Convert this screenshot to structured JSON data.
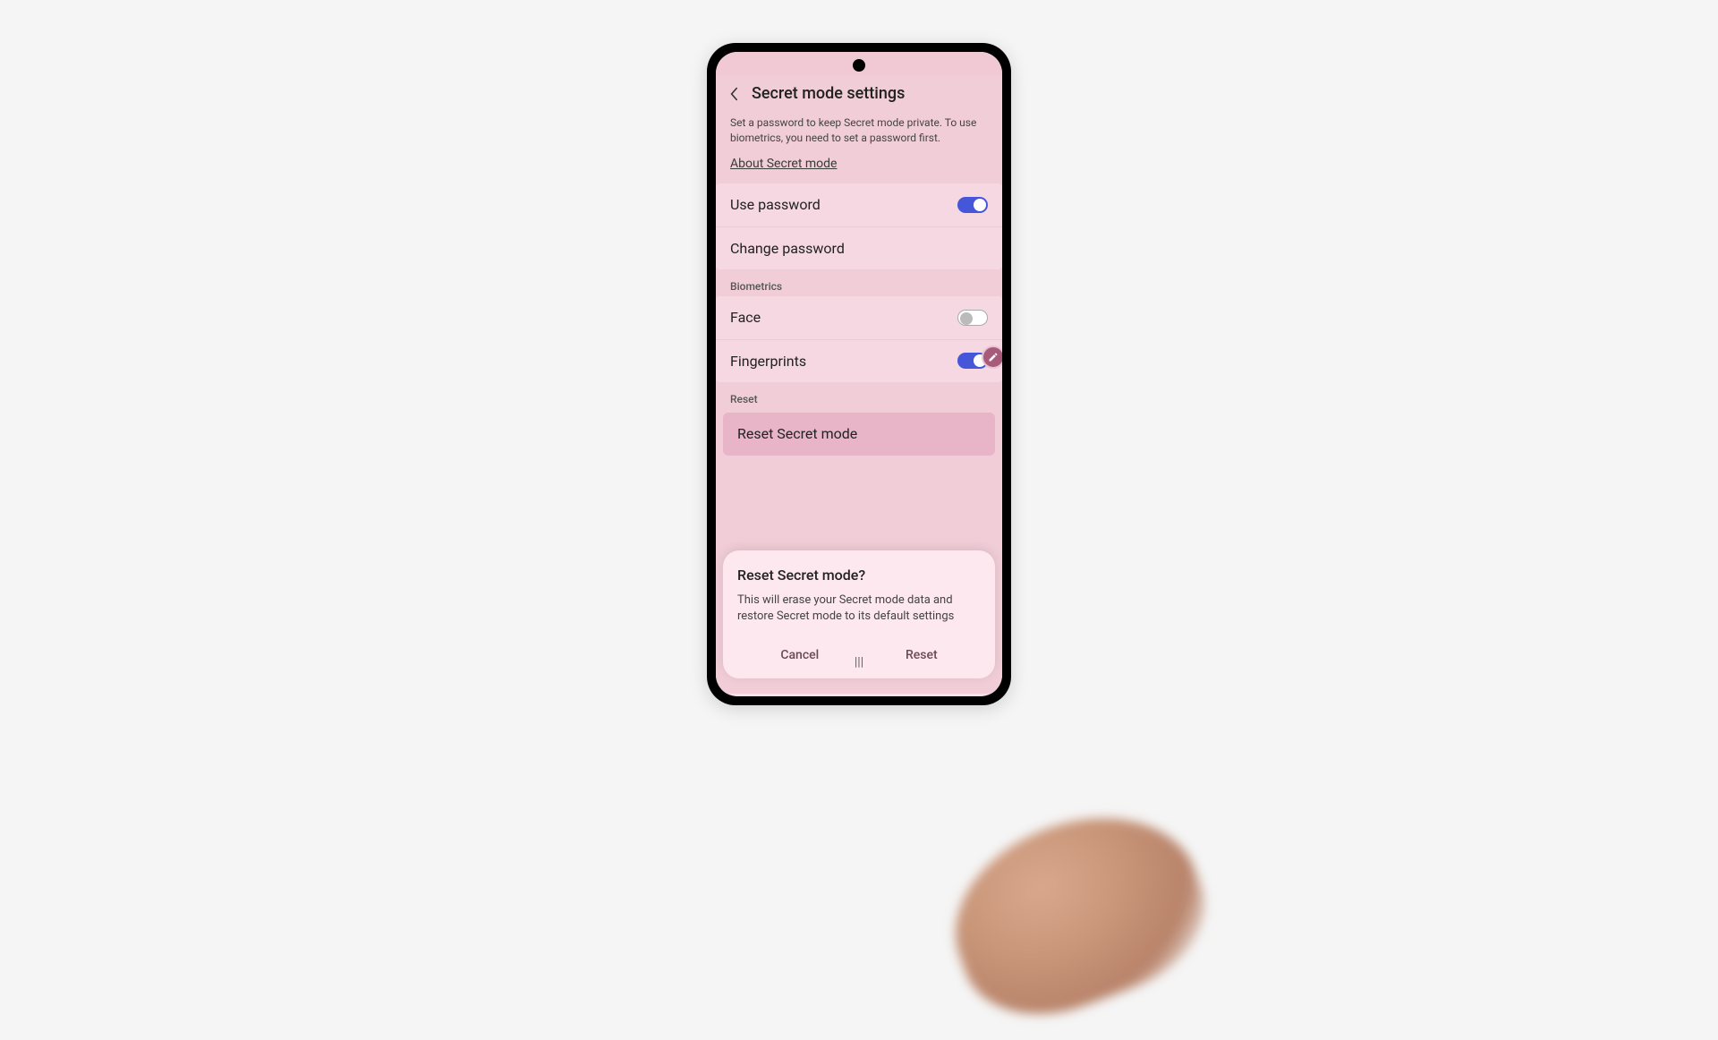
{
  "header": {
    "title": "Secret mode settings"
  },
  "description": "Set a password to keep Secret mode private. To use biometrics, you need to set a password first.",
  "about_link": "About Secret mode",
  "password_section": {
    "use_password": {
      "label": "Use password",
      "enabled": true
    },
    "change_password": {
      "label": "Change password"
    }
  },
  "biometrics_section": {
    "header": "Biometrics",
    "face": {
      "label": "Face",
      "enabled": false
    },
    "fingerprints": {
      "label": "Fingerprints",
      "enabled": true
    }
  },
  "reset_section": {
    "header": "Reset",
    "reset_item": {
      "label": "Reset Secret mode"
    }
  },
  "dialog": {
    "title": "Reset Secret mode?",
    "body": "This will erase your Secret mode data and restore Secret mode to its default settings",
    "cancel": "Cancel",
    "confirm": "Reset"
  },
  "colors": {
    "accent": "#4556d9",
    "screen_bg": "#f7e1e8"
  }
}
